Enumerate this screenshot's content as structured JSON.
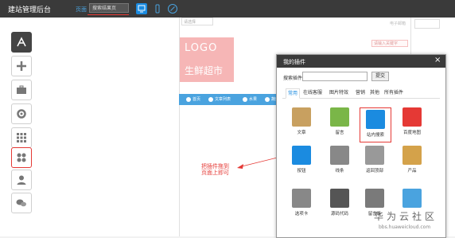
{
  "topbar": {
    "brand": "建站管理后台",
    "page_link": "页面",
    "page_select": "搜索结果页",
    "icons": [
      "desktop-icon",
      "mobile-icon",
      "link-icon"
    ]
  },
  "canvas": {
    "mini_select": "请选择",
    "top_right_text": "电子邮箱",
    "search_placeholder": "请输入关键字",
    "logo_text": "LOGO",
    "logo_sub": "生鲜超市",
    "nav_items": [
      "首页",
      "文章列表",
      "水果",
      "蔬菜"
    ]
  },
  "sidebar": {
    "items": [
      {
        "name": "app-store-icon"
      },
      {
        "name": "add-icon"
      },
      {
        "name": "briefcase-icon"
      },
      {
        "name": "settings-icon"
      },
      {
        "name": "grid-icon"
      },
      {
        "name": "plugins-icon"
      },
      {
        "name": "user-icon"
      },
      {
        "name": "chat-icon"
      }
    ]
  },
  "annotation": "把插件拖到\n页面上即可",
  "dialog": {
    "title": "我的插件",
    "close": "×",
    "search_label": "搜索插件",
    "search_button": "提交",
    "tabs": [
      "常用",
      "在线客服",
      "图片特效",
      "营销",
      "其他",
      "所有插件"
    ],
    "plugins": [
      {
        "label": "文章",
        "icon": "article-icon",
        "color": "#c8a060"
      },
      {
        "label": "留言",
        "icon": "message-icon",
        "color": "#7ab648"
      },
      {
        "label": "站内搜索",
        "icon": "site-search-icon",
        "color": "#1b8be0"
      },
      {
        "label": "百度地图",
        "icon": "baidu-map-icon",
        "color": "#e53935"
      },
      {
        "label": "按钮",
        "icon": "button-icon",
        "color": "#1b8be0"
      },
      {
        "label": "线条",
        "icon": "line-icon",
        "color": "#888888"
      },
      {
        "label": "返回顶部",
        "icon": "back-to-top-icon",
        "color": "#999999"
      },
      {
        "label": "产品",
        "icon": "product-icon",
        "color": "#d4a24a"
      },
      {
        "label": "选项卡",
        "icon": "tab-card-icon",
        "color": "#888888"
      },
      {
        "label": "源码代码",
        "icon": "source-code-icon",
        "color": "#555555"
      },
      {
        "label": "留言板",
        "icon": "guestbook-icon",
        "color": "#7a7a7a"
      },
      {
        "label": "",
        "icon": "share-icon",
        "color": "#4aa3df"
      }
    ]
  },
  "watermark": {
    "text": "华为云社区",
    "sub": "bbs.huaweicloud.com"
  }
}
